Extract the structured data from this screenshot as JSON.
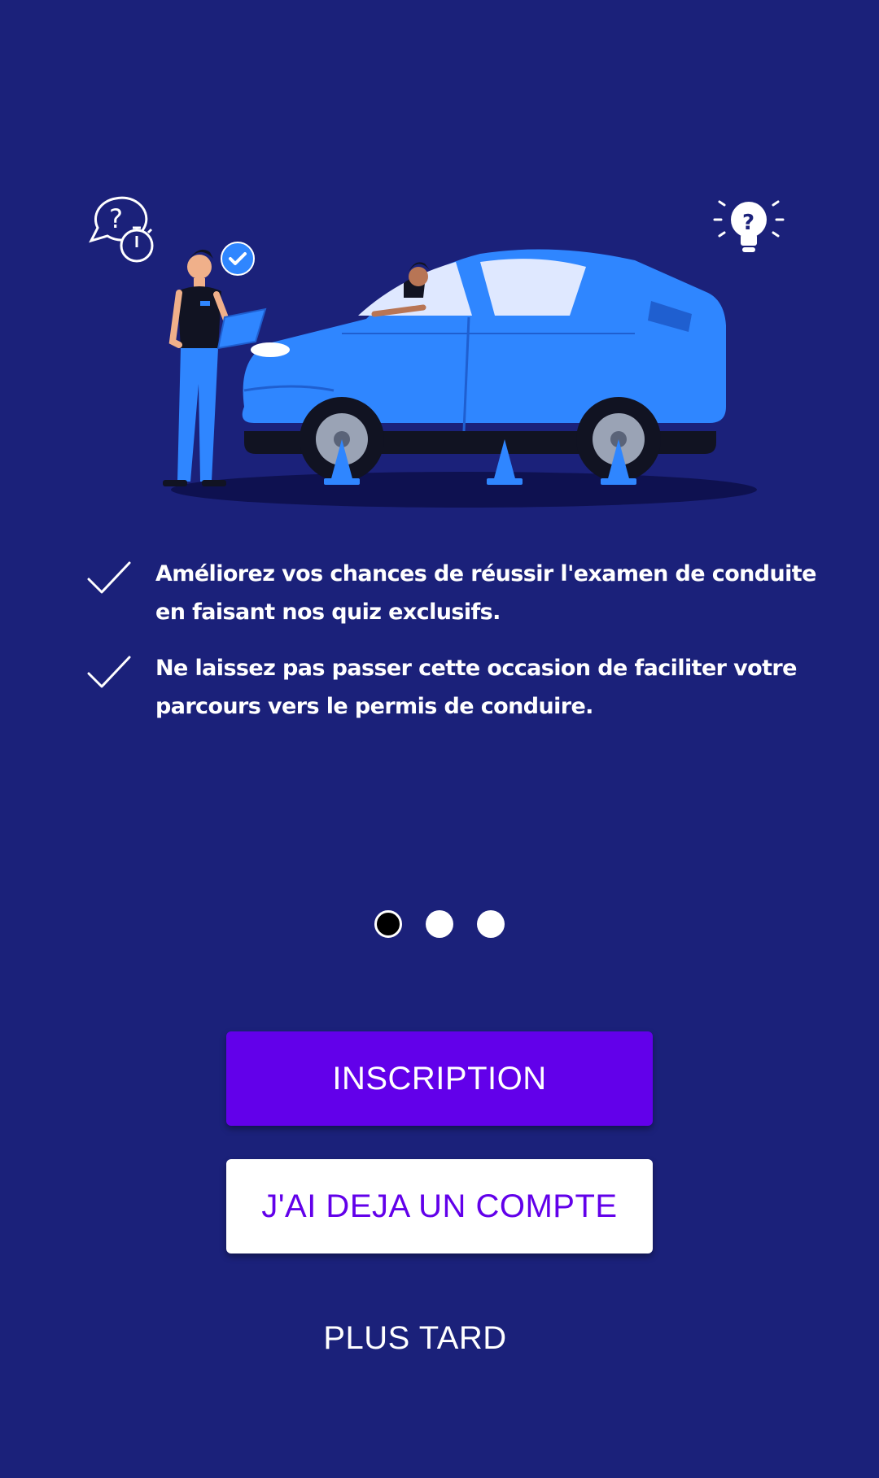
{
  "onboarding": {
    "features": [
      "Améliorez vos chances de réussir l'examen de conduite en faisant nos quiz exclusifs.",
      "Ne laissez pas passer cette occasion de faciliter votre parcours vers le permis de conduire."
    ],
    "pager": {
      "total_pages": 3,
      "current_page": 1
    },
    "buttons": {
      "signup_label": "INSCRIPTION",
      "login_label": "J'AI DEJA UN COMPTE",
      "later_label": "PLUS TARD"
    },
    "icons": {
      "question_timer": "question-timer-icon",
      "lightbulb_question": "lightbulb-question-icon",
      "check": "check-icon"
    }
  },
  "colors": {
    "background": "#1b217a",
    "primary": "#6200ea",
    "car_blue": "#2f86ff",
    "white": "#ffffff"
  }
}
